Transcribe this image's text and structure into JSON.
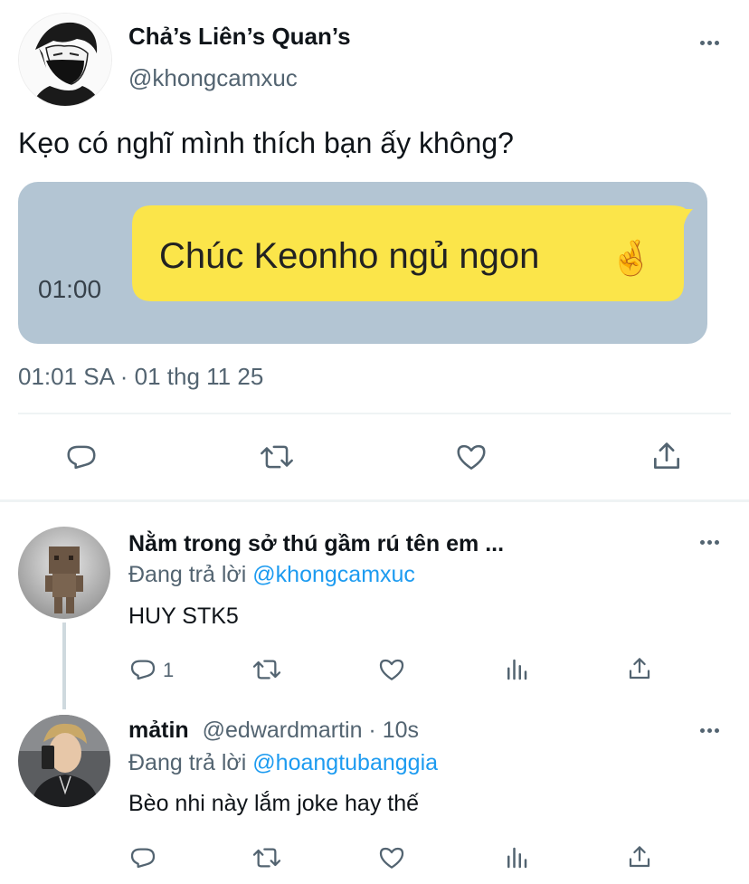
{
  "tweet": {
    "display_name": "Chả’s Liên’s Quan’s",
    "handle": "@khongcamxuc",
    "text": "Kẹo có nghĩ mình thích bạn ấy không?",
    "media": {
      "time_label": "01:00",
      "bubble_text": "Chúc Keonho ngủ ngon",
      "emoji": "🤞"
    },
    "timestamp": "01:01 SA · 01 thg 11 25",
    "actions": [
      "reply-icon",
      "retweet-icon",
      "like-icon",
      "share-icon"
    ]
  },
  "replies": [
    {
      "display_name": "Nằm trong sở thú gầm rú tên em ...",
      "replying_prefix": "Đang trả lời",
      "replying_to": "@khongcamxuc",
      "text": "HUY STK5",
      "reply_count": "1"
    },
    {
      "display_name": "mảtin",
      "handle_time": "@edwardmartin · 10s",
      "replying_prefix": "Đang trả lời",
      "replying_to": "@hoangtubanggia",
      "text": "Bèo nhi này lắm joke hay thế"
    }
  ],
  "colors": {
    "accent": "#1d9bf0",
    "muted": "#536471",
    "media_bg": "#b3c5d3",
    "bubble": "#fbe54a"
  }
}
